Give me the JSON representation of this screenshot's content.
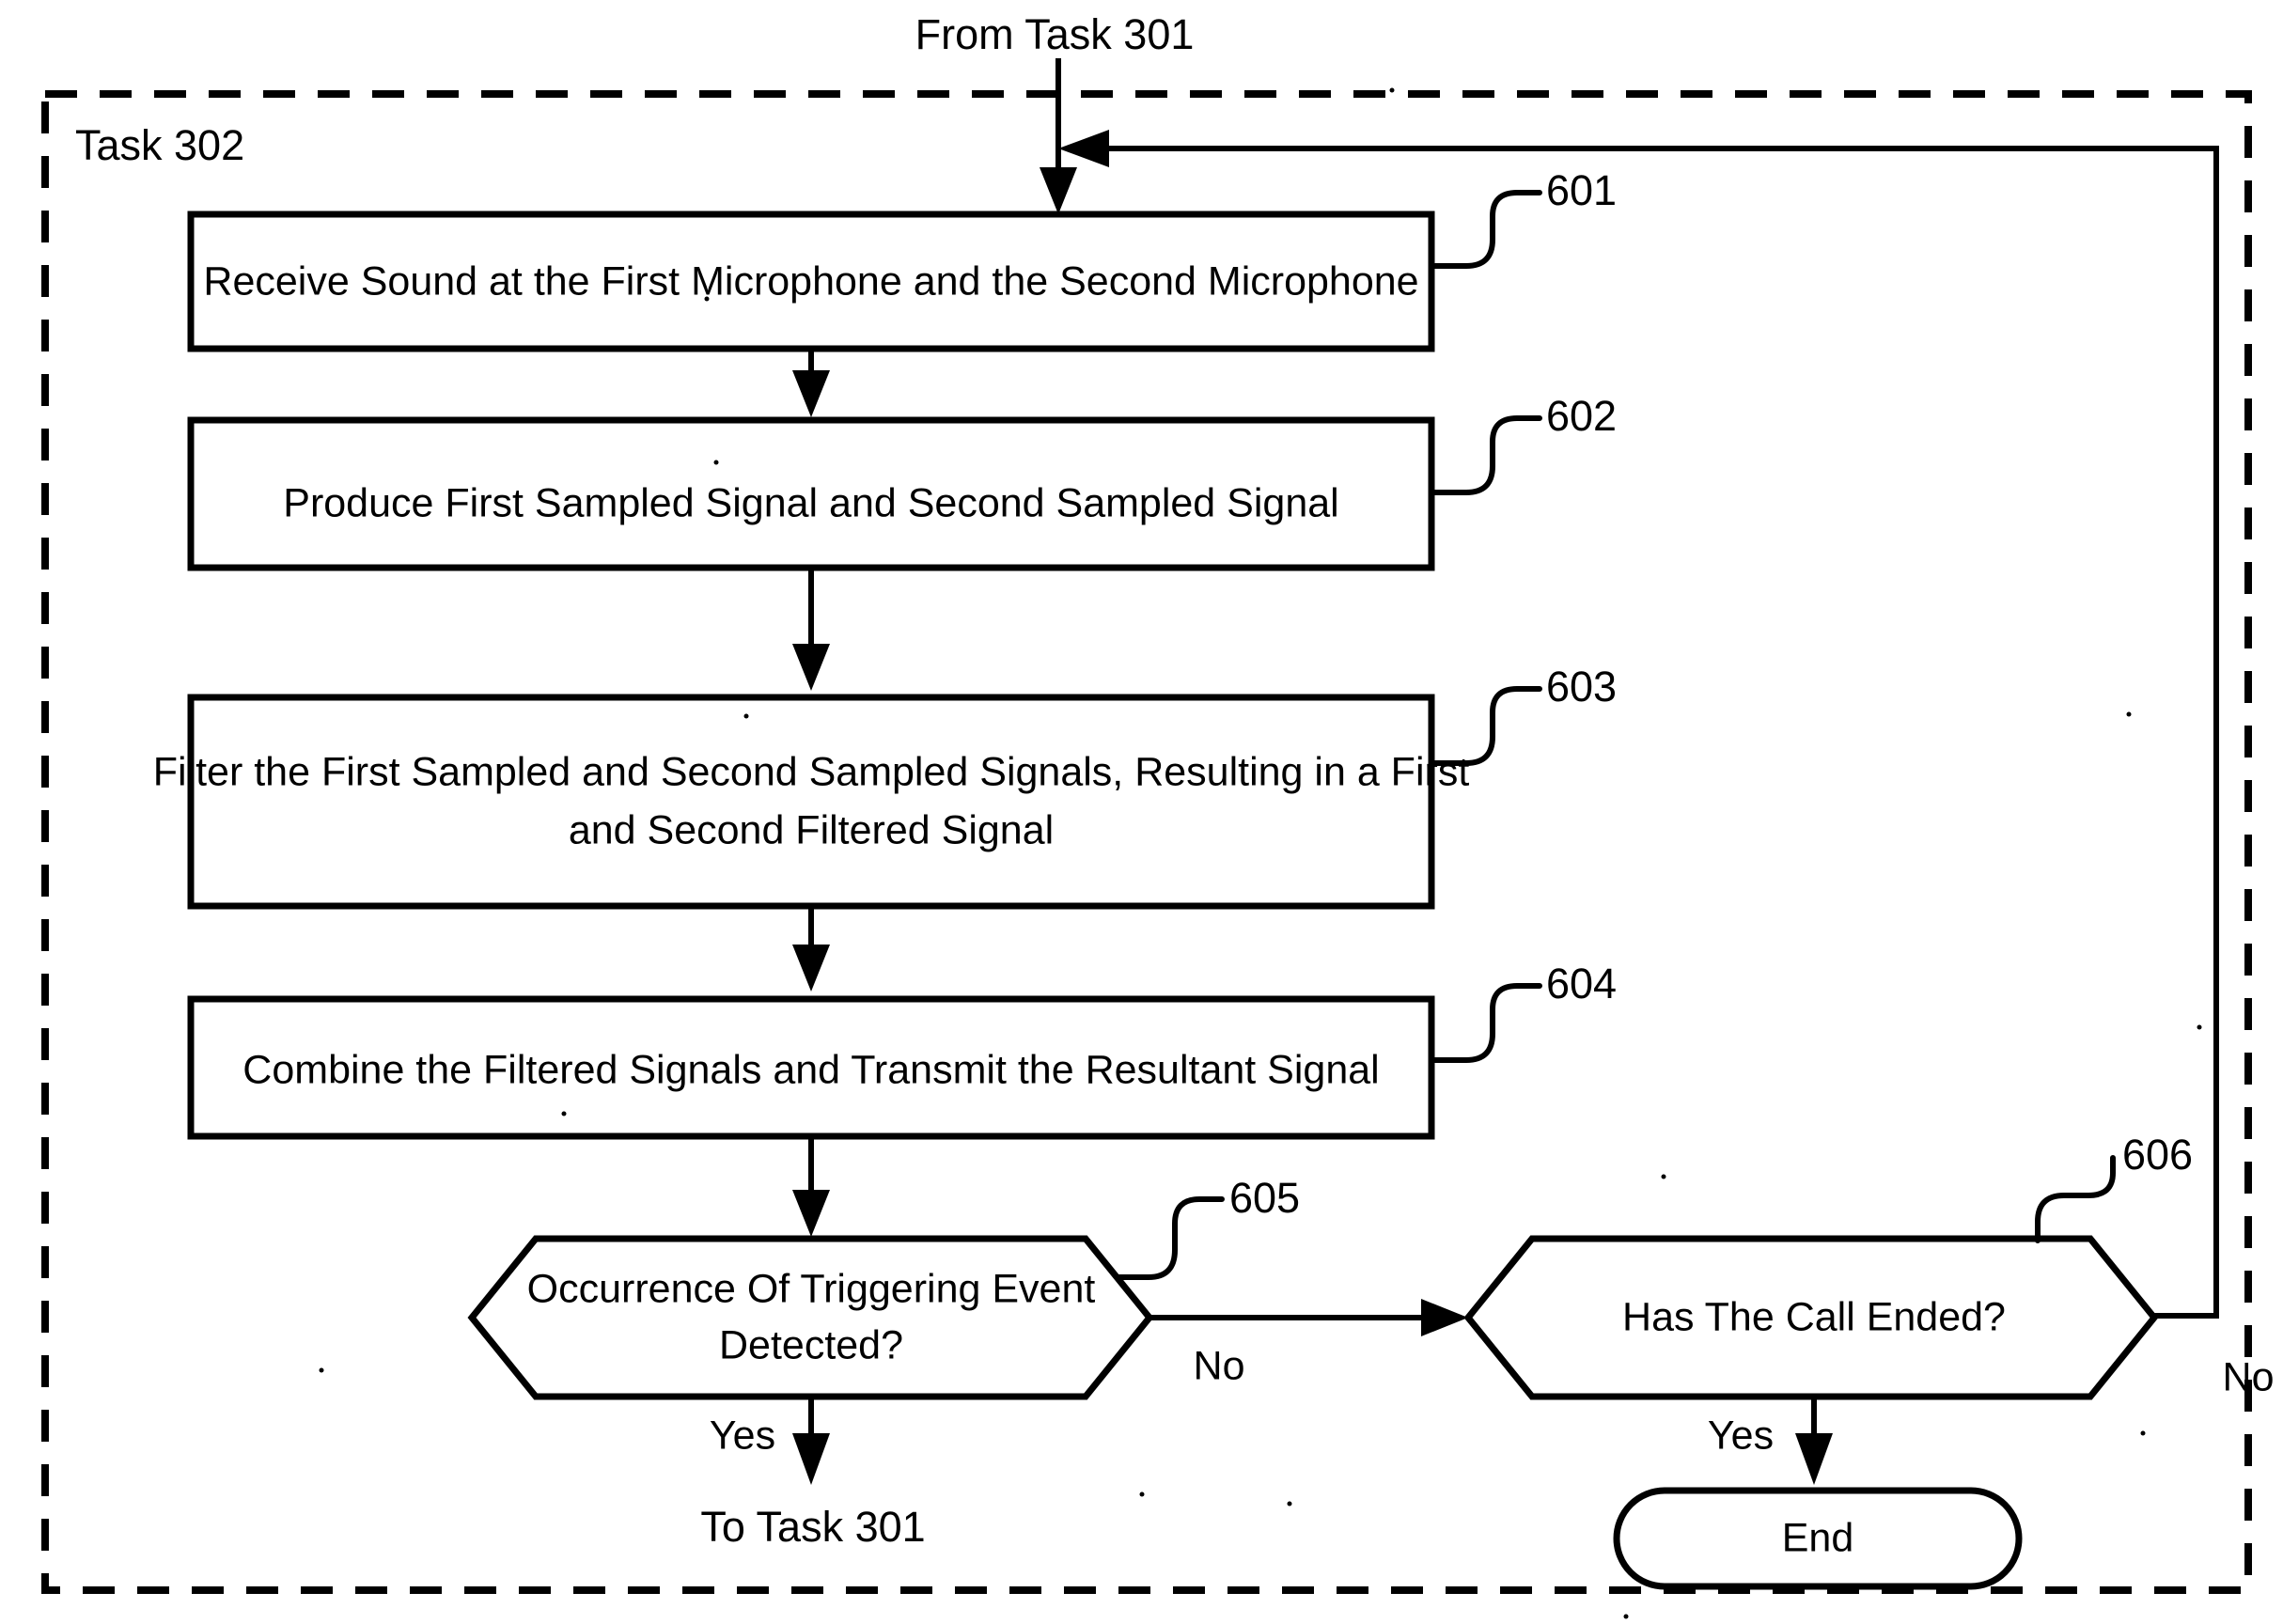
{
  "figure": {
    "type": "patent-flowchart",
    "entry_label": "From Task 301",
    "boundary_label": "Task 302",
    "exit_label": "To Task 301"
  },
  "nodes": [
    {
      "id": "601",
      "ref": "601",
      "shape": "process",
      "text": "Receive Sound at the First Microphone and the Second Microphone",
      "lines": [
        "Receive Sound at the First Microphone and the Second Microphone"
      ]
    },
    {
      "id": "602",
      "ref": "602",
      "shape": "process",
      "text": "Produce First Sampled Signal and Second Sampled Signal",
      "lines": [
        "Produce First Sampled Signal and Second Sampled Signal"
      ]
    },
    {
      "id": "603",
      "ref": "603",
      "shape": "process",
      "text": "Filter the First Sampled and Second Sampled Signals, Resulting in a First and Second Filtered Signal",
      "lines": [
        "Filter the First Sampled and Second Sampled Signals, Resulting in a First",
        "and Second Filtered Signal"
      ]
    },
    {
      "id": "604",
      "ref": "604",
      "shape": "process",
      "text": "Combine the Filtered Signals and Transmit the Resultant Signal",
      "lines": [
        "Combine the Filtered Signals and Transmit the Resultant Signal"
      ]
    },
    {
      "id": "605",
      "ref": "605",
      "shape": "decision-hexagon",
      "text": "Occurrence Of Triggering Event Detected?",
      "lines": [
        "Occurrence Of Triggering Event",
        "Detected?"
      ]
    },
    {
      "id": "606",
      "ref": "606",
      "shape": "decision-hexagon",
      "text": "Has The Call Ended?",
      "lines": [
        "Has The Call Ended?"
      ]
    },
    {
      "id": "end",
      "ref": "",
      "shape": "terminator",
      "text": "End",
      "lines": [
        "End"
      ]
    }
  ],
  "edges": [
    {
      "from": "entry",
      "to": "601",
      "label": ""
    },
    {
      "from": "601",
      "to": "602",
      "label": ""
    },
    {
      "from": "602",
      "to": "603",
      "label": ""
    },
    {
      "from": "603",
      "to": "604",
      "label": ""
    },
    {
      "from": "604",
      "to": "605",
      "label": ""
    },
    {
      "from": "605",
      "to": "exit",
      "label": "Yes"
    },
    {
      "from": "605",
      "to": "606",
      "label": "No"
    },
    {
      "from": "606",
      "to": "end",
      "label": "Yes"
    },
    {
      "from": "606",
      "to": "601",
      "label": "No"
    }
  ],
  "edge_labels": {
    "yes_605": "Yes",
    "no_605": "No",
    "yes_606": "Yes",
    "no_606": "No"
  },
  "colors": {
    "stroke": "#000000",
    "fill": "#ffffff",
    "background": "#ffffff"
  }
}
